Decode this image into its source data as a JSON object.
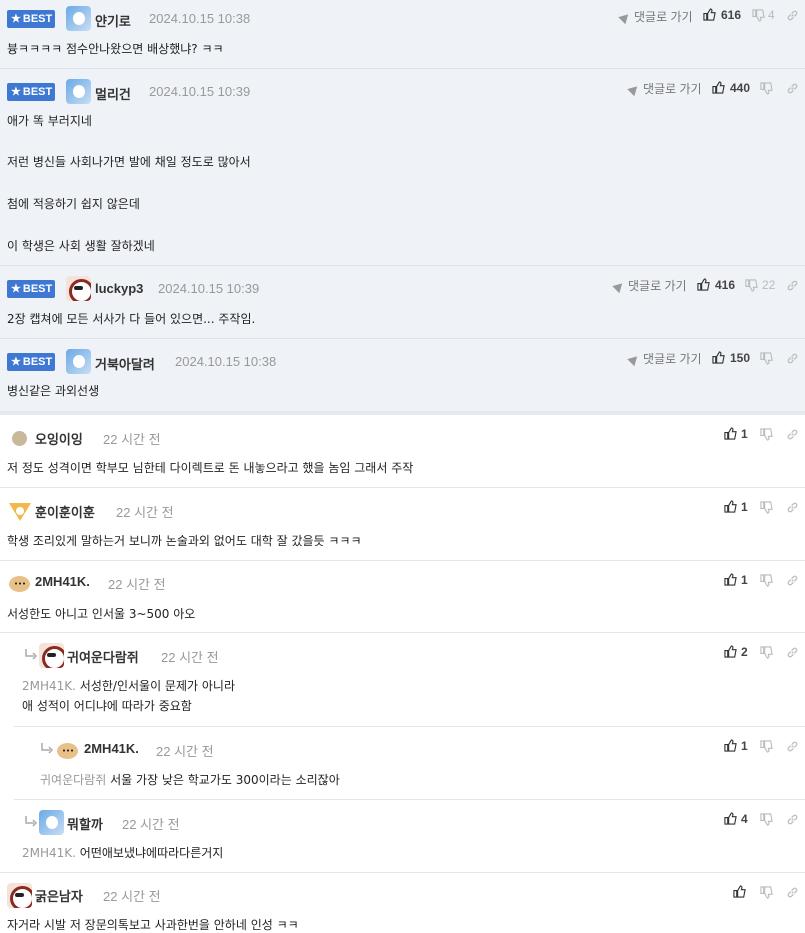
{
  "best_comments": [
    {
      "badge": "BEST",
      "nick": "얀기로",
      "time": "2024.10.15 10:38",
      "goto": "댓글로 가기",
      "likes": "616",
      "dislikes": "4",
      "lines": [
        "븅ㅋㅋㅋㅋ 점수안나왔으면 배상했냐? ㅋㅋ"
      ]
    },
    {
      "badge": "BEST",
      "nick": "멀리건",
      "time": "2024.10.15 10:39",
      "goto": "댓글로 가기",
      "likes": "440",
      "dislikes": "",
      "lines": [
        "애가 똑 부러지네",
        "저런 병신들 사회나가면 발에 채일 정도로 많아서",
        "첨에 적응하기 쉽지 않은데",
        "이 학생은 사회 생활 잘하겠네"
      ]
    },
    {
      "badge": "BEST",
      "nick": "luckyp3",
      "time": "2024.10.15 10:39",
      "goto": "댓글로 가기",
      "likes": "416",
      "dislikes": "22",
      "lines": [
        "2장 캡쳐에 모든 서사가 다 들어 있으면... 주작임."
      ]
    },
    {
      "badge": "BEST",
      "nick": "거북아달려",
      "time": "2024.10.15 10:38",
      "goto": "댓글로 가기",
      "likes": "150",
      "dislikes": "",
      "lines": [
        "병신같은 과외선생"
      ]
    }
  ],
  "comments": [
    {
      "nick": "오잉이잉",
      "time": "22 시간 전",
      "likes": "1",
      "text": "저 정도 성격이면 학부모 님한테 다이렉트로 돈 내놓으라고 했을 놈임 그래서 주작"
    },
    {
      "nick": "훈이훈이훈",
      "time": "22 시간 전",
      "likes": "1",
      "text": "학생 조리있게 말하는거 보니까 논술과외 없어도 대학 잘 갔을듯 ㅋㅋㅋ"
    },
    {
      "nick": "2MH41K.",
      "time": "22 시간 전",
      "likes": "1",
      "text": "서성한도 아니고 인서울 3~500 아오"
    },
    {
      "nick": "귀여운다람쥐",
      "time": "22 시간 전",
      "likes": "2",
      "mention": "2MH41K.",
      "text": "서성한/인서울이 문제가 아니라",
      "text2": "애 성적이 어디냐에 따라가 중요함"
    },
    {
      "nick": "2MH41K.",
      "time": "22 시간 전",
      "likes": "1",
      "mention": "귀여운다람쥐",
      "text": "서울 가장 낮은 학교가도 300이라는 소리잖아"
    },
    {
      "nick": "뭐할까",
      "time": "22 시간 전",
      "likes": "4",
      "mention": "2MH41K.",
      "text": "어떤애보냈냐에따라다른거지"
    },
    {
      "nick": "굵은남자",
      "time": "22 시간 전",
      "likes": "",
      "text": "자거라 시발 저 장문의톡보고 사과한번을 안하네 인성 ㅋㅋ"
    }
  ],
  "icons": {
    "like": "thumbs-up-icon",
    "dislike": "thumbs-down-icon",
    "link": "link-icon",
    "goto": "arrow-icon",
    "star": "star-icon",
    "reply": "reply-arrow-icon"
  },
  "colors": {
    "best_badge": "#3f78d3",
    "best_bg": "#eff2f7"
  }
}
